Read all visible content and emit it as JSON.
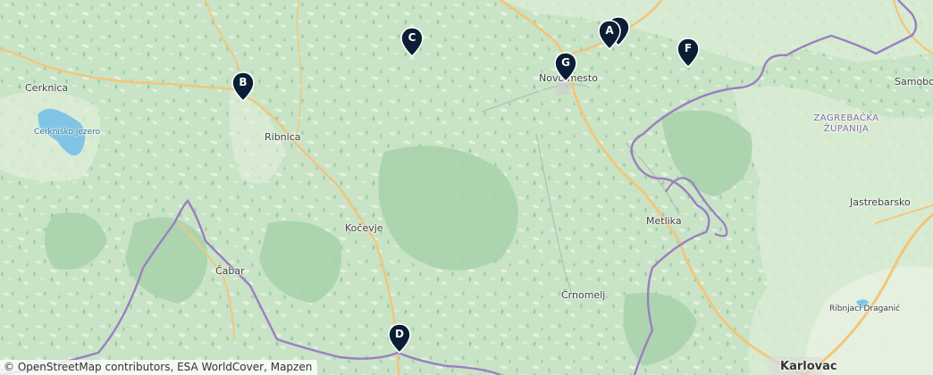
{
  "map": {
    "places": [
      {
        "id": "cerknica",
        "name": "Cerknica"
      },
      {
        "id": "cerknisko-jezero",
        "name": "Cerkniško jezero"
      },
      {
        "id": "ribnica",
        "name": "Ribnica"
      },
      {
        "id": "kocevje",
        "name": "Kočevje"
      },
      {
        "id": "cabar",
        "name": "Čabar"
      },
      {
        "id": "novo-mesto",
        "name": "Novo mesto"
      },
      {
        "id": "metlika",
        "name": "Metlika"
      },
      {
        "id": "crnomelj",
        "name": "Črnomelj"
      },
      {
        "id": "zagrebacka",
        "name": "ZAGREBAČKA ŽUPANIJA"
      },
      {
        "id": "jastrebarsko",
        "name": "Jastrebarsko"
      },
      {
        "id": "samobor",
        "name": "Samobo"
      },
      {
        "id": "ribnjaci",
        "name": "Ribnjaci Draganić"
      },
      {
        "id": "karlovac",
        "name": "Karlovac"
      }
    ],
    "markers": [
      {
        "id": "a",
        "label": "A"
      },
      {
        "id": "b",
        "label": "B"
      },
      {
        "id": "c",
        "label": "C"
      },
      {
        "id": "d",
        "label": "D"
      },
      {
        "id": "e",
        "label": ""
      },
      {
        "id": "f",
        "label": "F"
      },
      {
        "id": "g",
        "label": "G"
      }
    ],
    "attribution": {
      "prefix": "© ",
      "links": [
        "OpenStreetMap contributors",
        "ESA WorldCover",
        "Mapzen"
      ]
    },
    "colors": {
      "forest": "#a9d3ac",
      "land": "#cde6cb",
      "clearing": "#e9f1e2",
      "water": "#80c4e6",
      "border": "#9b7fc0",
      "road": "#f3c57b",
      "marker": "#0b1e36"
    }
  }
}
